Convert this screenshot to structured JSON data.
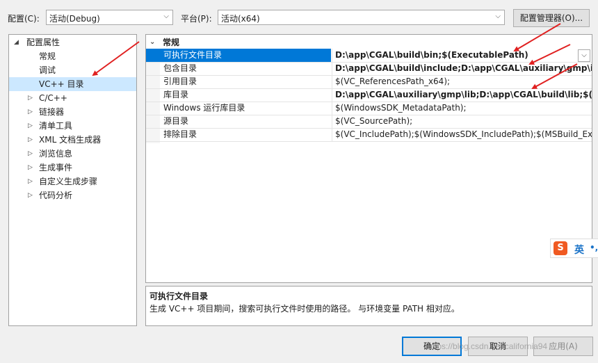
{
  "toolbar": {
    "config_label": "配置(C):",
    "config_value": "活动(Debug)",
    "platform_label": "平台(P):",
    "platform_value": "活动(x64)",
    "config_manager_button": "配置管理器(O)..."
  },
  "tree": {
    "root": "配置属性",
    "items": [
      {
        "label": "常规"
      },
      {
        "label": "调试"
      },
      {
        "label": "VC++ 目录"
      },
      {
        "label": "C/C++"
      },
      {
        "label": "链接器"
      },
      {
        "label": "清单工具"
      },
      {
        "label": "XML 文档生成器"
      },
      {
        "label": "浏览信息"
      },
      {
        "label": "生成事件"
      },
      {
        "label": "自定义生成步骤"
      },
      {
        "label": "代码分析"
      }
    ],
    "selected": "VC++ 目录"
  },
  "grid": {
    "category": "常规",
    "rows": [
      {
        "name": "可执行文件目录",
        "value": "D:\\app\\CGAL\\build\\bin;$(ExecutablePath)"
      },
      {
        "name": "包含目录",
        "value": "D:\\app\\CGAL\\build\\include;D:\\app\\CGAL\\auxiliary\\gmp\\inc"
      },
      {
        "name": "引用目录",
        "value": "$(VC_ReferencesPath_x64);"
      },
      {
        "name": "库目录",
        "value": "D:\\app\\CGAL\\auxiliary\\gmp\\lib;D:\\app\\CGAL\\build\\lib;$(Lil"
      },
      {
        "name": "Windows 运行库目录",
        "value": "$(WindowsSDK_MetadataPath);"
      },
      {
        "name": "源目录",
        "value": "$(VC_SourcePath);"
      },
      {
        "name": "排除目录",
        "value": "$(VC_IncludePath);$(WindowsSDK_IncludePath);$(MSBuild_Execu"
      }
    ]
  },
  "description": {
    "title": "可执行文件目录",
    "text": "生成 VC++ 项目期间，搜索可执行文件时使用的路径。 与环境变量 PATH 相对应。"
  },
  "ime": {
    "logo": "S",
    "mode": "英",
    "punct": "•,"
  },
  "buttons": {
    "ok": "确定",
    "cancel": "取消",
    "apply": "应用(A)"
  },
  "watermark": "https://blog.csdn.net/california94",
  "colors": {
    "selection": "#0078d7",
    "tree_selection": "#cce8ff",
    "annotation_arrow": "#e02020"
  }
}
